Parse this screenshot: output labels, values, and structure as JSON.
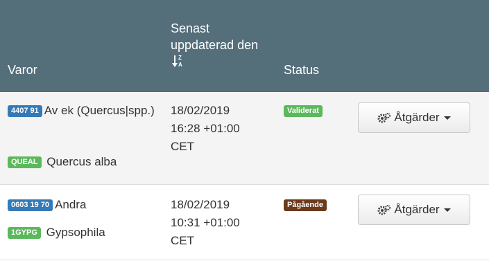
{
  "header": {
    "col_goods": "Varor",
    "col_updated": "Senast uppdaterad den",
    "col_status": "Status"
  },
  "rows": [
    {
      "code": "4407 91",
      "code_label": "Av ek (Quercus|spp.)",
      "species_code": "QUEAL",
      "species_name": "Quercus alba",
      "date_line1": "18/02/2019",
      "date_line2": "16:28 +01:00",
      "date_line3": "CET",
      "status": "Validerat",
      "status_color": "#5cb85c",
      "action_label": "Åtgärder"
    },
    {
      "code": "0603 19 70",
      "code_label": "Andra",
      "species_code": "1GYPG",
      "species_name": "Gypsophila",
      "date_line1": "18/02/2019",
      "date_line2": "10:31 +01:00",
      "date_line3": "CET",
      "status": "Pågående",
      "status_color": "#6b3a1c",
      "action_label": "Åtgärder"
    }
  ],
  "icons": {
    "sort": "sort-alpha-desc-icon",
    "actions": "cogs-icon",
    "dropdown": "caret-down-icon"
  }
}
